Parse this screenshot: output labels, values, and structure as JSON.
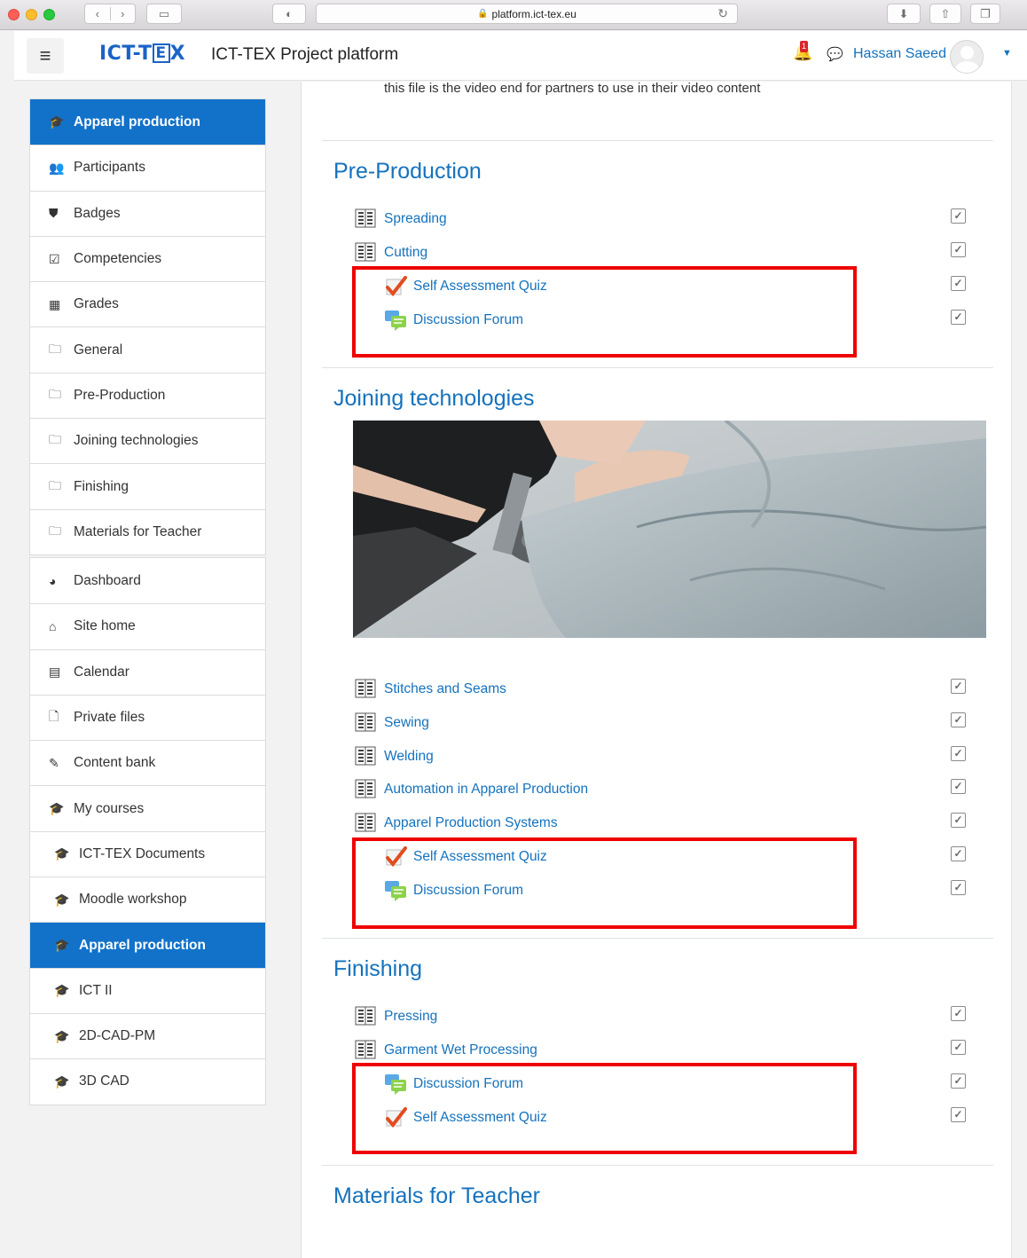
{
  "browser": {
    "url": "platform.ict-tex.eu"
  },
  "navbar": {
    "menu_icon": "hamburger-icon",
    "logo_text": "ICT-TEX",
    "site_name": "ICT-TEX Project platform",
    "notification_count": "1",
    "user_name": "Hassan Saeed"
  },
  "sidebar": {
    "course_nav": [
      {
        "label": "Apparel production",
        "icon": "graduation-cap-icon",
        "active": true
      },
      {
        "label": "Participants",
        "icon": "users-icon"
      },
      {
        "label": "Badges",
        "icon": "shield-icon"
      },
      {
        "label": "Competencies",
        "icon": "checkbox-icon"
      },
      {
        "label": "Grades",
        "icon": "table-icon"
      },
      {
        "label": "General",
        "icon": "folder-icon"
      },
      {
        "label": "Pre-Production",
        "icon": "folder-icon"
      },
      {
        "label": "Joining technologies",
        "icon": "folder-icon"
      },
      {
        "label": "Finishing",
        "icon": "folder-icon"
      },
      {
        "label": "Materials for Teacher",
        "icon": "folder-icon"
      }
    ],
    "site_nav": [
      {
        "label": "Dashboard",
        "icon": "dashboard-icon"
      },
      {
        "label": "Site home",
        "icon": "home-icon"
      },
      {
        "label": "Calendar",
        "icon": "calendar-icon"
      },
      {
        "label": "Private files",
        "icon": "file-icon"
      },
      {
        "label": "Content bank",
        "icon": "brush-icon"
      },
      {
        "label": "My courses",
        "icon": "graduation-cap-icon"
      },
      {
        "label": "ICT-TEX Documents",
        "icon": "graduation-cap-icon"
      },
      {
        "label": "Moodle workshop",
        "icon": "graduation-cap-icon"
      },
      {
        "label": "Apparel production",
        "icon": "graduation-cap-icon",
        "active": true
      },
      {
        "label": "ICT II",
        "icon": "graduation-cap-icon"
      },
      {
        "label": "2D-CAD-PM",
        "icon": "graduation-cap-icon"
      },
      {
        "label": "3D CAD",
        "icon": "graduation-cap-icon"
      }
    ]
  },
  "main": {
    "intro_text": "this file is the video end for partners to use in their video content",
    "sections": [
      {
        "title": "Pre-Production",
        "activities": [
          "Spreading",
          "Cutting"
        ],
        "highlighted": [
          "Self Assessment Quiz",
          "Discussion Forum"
        ]
      },
      {
        "title": "Joining technologies",
        "image": "sewing-machine-photo",
        "activities": [
          "Stitches and Seams",
          "Sewing",
          "Welding",
          "Automation in Apparel Production",
          "Apparel Production Systems"
        ],
        "highlighted": [
          "Self Assessment Quiz",
          "Discussion Forum"
        ]
      },
      {
        "title": "Finishing",
        "activities": [
          "Pressing",
          "Garment Wet Processing"
        ],
        "highlighted": [
          "Discussion Forum",
          "Self Assessment Quiz"
        ]
      },
      {
        "title": "Materials for Teacher"
      }
    ]
  },
  "colors": {
    "link": "#1572bd",
    "active_nav": "#1272c9",
    "highlight_box": "#ef0000"
  }
}
